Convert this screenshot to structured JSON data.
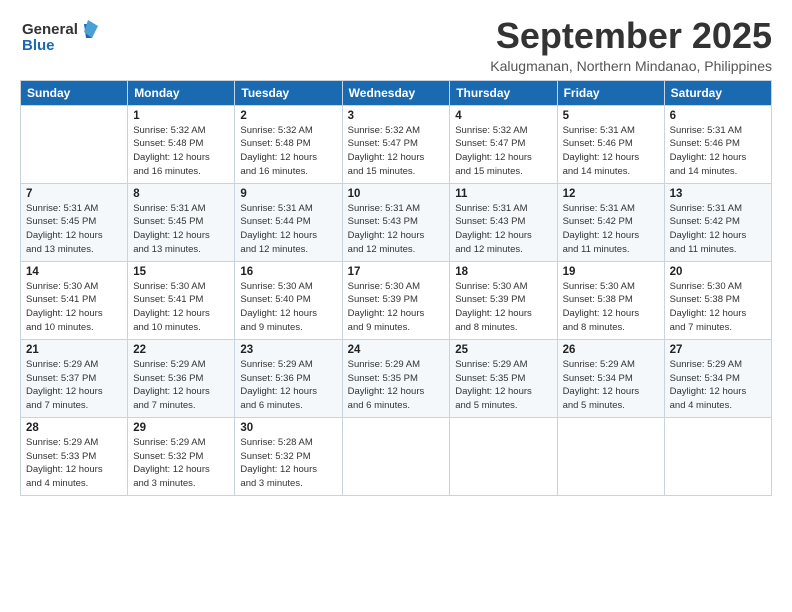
{
  "logo": {
    "line1": "General",
    "line2": "Blue"
  },
  "title": "September 2025",
  "subtitle": "Kalugmanan, Northern Mindanao, Philippines",
  "days_of_week": [
    "Sunday",
    "Monday",
    "Tuesday",
    "Wednesday",
    "Thursday",
    "Friday",
    "Saturday"
  ],
  "weeks": [
    [
      {
        "day": "",
        "info": ""
      },
      {
        "day": "1",
        "info": "Sunrise: 5:32 AM\nSunset: 5:48 PM\nDaylight: 12 hours\nand 16 minutes."
      },
      {
        "day": "2",
        "info": "Sunrise: 5:32 AM\nSunset: 5:48 PM\nDaylight: 12 hours\nand 16 minutes."
      },
      {
        "day": "3",
        "info": "Sunrise: 5:32 AM\nSunset: 5:47 PM\nDaylight: 12 hours\nand 15 minutes."
      },
      {
        "day": "4",
        "info": "Sunrise: 5:32 AM\nSunset: 5:47 PM\nDaylight: 12 hours\nand 15 minutes."
      },
      {
        "day": "5",
        "info": "Sunrise: 5:31 AM\nSunset: 5:46 PM\nDaylight: 12 hours\nand 14 minutes."
      },
      {
        "day": "6",
        "info": "Sunrise: 5:31 AM\nSunset: 5:46 PM\nDaylight: 12 hours\nand 14 minutes."
      }
    ],
    [
      {
        "day": "7",
        "info": "Sunrise: 5:31 AM\nSunset: 5:45 PM\nDaylight: 12 hours\nand 13 minutes."
      },
      {
        "day": "8",
        "info": "Sunrise: 5:31 AM\nSunset: 5:45 PM\nDaylight: 12 hours\nand 13 minutes."
      },
      {
        "day": "9",
        "info": "Sunrise: 5:31 AM\nSunset: 5:44 PM\nDaylight: 12 hours\nand 12 minutes."
      },
      {
        "day": "10",
        "info": "Sunrise: 5:31 AM\nSunset: 5:43 PM\nDaylight: 12 hours\nand 12 minutes."
      },
      {
        "day": "11",
        "info": "Sunrise: 5:31 AM\nSunset: 5:43 PM\nDaylight: 12 hours\nand 12 minutes."
      },
      {
        "day": "12",
        "info": "Sunrise: 5:31 AM\nSunset: 5:42 PM\nDaylight: 12 hours\nand 11 minutes."
      },
      {
        "day": "13",
        "info": "Sunrise: 5:31 AM\nSunset: 5:42 PM\nDaylight: 12 hours\nand 11 minutes."
      }
    ],
    [
      {
        "day": "14",
        "info": "Sunrise: 5:30 AM\nSunset: 5:41 PM\nDaylight: 12 hours\nand 10 minutes."
      },
      {
        "day": "15",
        "info": "Sunrise: 5:30 AM\nSunset: 5:41 PM\nDaylight: 12 hours\nand 10 minutes."
      },
      {
        "day": "16",
        "info": "Sunrise: 5:30 AM\nSunset: 5:40 PM\nDaylight: 12 hours\nand 9 minutes."
      },
      {
        "day": "17",
        "info": "Sunrise: 5:30 AM\nSunset: 5:39 PM\nDaylight: 12 hours\nand 9 minutes."
      },
      {
        "day": "18",
        "info": "Sunrise: 5:30 AM\nSunset: 5:39 PM\nDaylight: 12 hours\nand 8 minutes."
      },
      {
        "day": "19",
        "info": "Sunrise: 5:30 AM\nSunset: 5:38 PM\nDaylight: 12 hours\nand 8 minutes."
      },
      {
        "day": "20",
        "info": "Sunrise: 5:30 AM\nSunset: 5:38 PM\nDaylight: 12 hours\nand 7 minutes."
      }
    ],
    [
      {
        "day": "21",
        "info": "Sunrise: 5:29 AM\nSunset: 5:37 PM\nDaylight: 12 hours\nand 7 minutes."
      },
      {
        "day": "22",
        "info": "Sunrise: 5:29 AM\nSunset: 5:36 PM\nDaylight: 12 hours\nand 7 minutes."
      },
      {
        "day": "23",
        "info": "Sunrise: 5:29 AM\nSunset: 5:36 PM\nDaylight: 12 hours\nand 6 minutes."
      },
      {
        "day": "24",
        "info": "Sunrise: 5:29 AM\nSunset: 5:35 PM\nDaylight: 12 hours\nand 6 minutes."
      },
      {
        "day": "25",
        "info": "Sunrise: 5:29 AM\nSunset: 5:35 PM\nDaylight: 12 hours\nand 5 minutes."
      },
      {
        "day": "26",
        "info": "Sunrise: 5:29 AM\nSunset: 5:34 PM\nDaylight: 12 hours\nand 5 minutes."
      },
      {
        "day": "27",
        "info": "Sunrise: 5:29 AM\nSunset: 5:34 PM\nDaylight: 12 hours\nand 4 minutes."
      }
    ],
    [
      {
        "day": "28",
        "info": "Sunrise: 5:29 AM\nSunset: 5:33 PM\nDaylight: 12 hours\nand 4 minutes."
      },
      {
        "day": "29",
        "info": "Sunrise: 5:29 AM\nSunset: 5:32 PM\nDaylight: 12 hours\nand 3 minutes."
      },
      {
        "day": "30",
        "info": "Sunrise: 5:28 AM\nSunset: 5:32 PM\nDaylight: 12 hours\nand 3 minutes."
      },
      {
        "day": "",
        "info": ""
      },
      {
        "day": "",
        "info": ""
      },
      {
        "day": "",
        "info": ""
      },
      {
        "day": "",
        "info": ""
      }
    ]
  ]
}
